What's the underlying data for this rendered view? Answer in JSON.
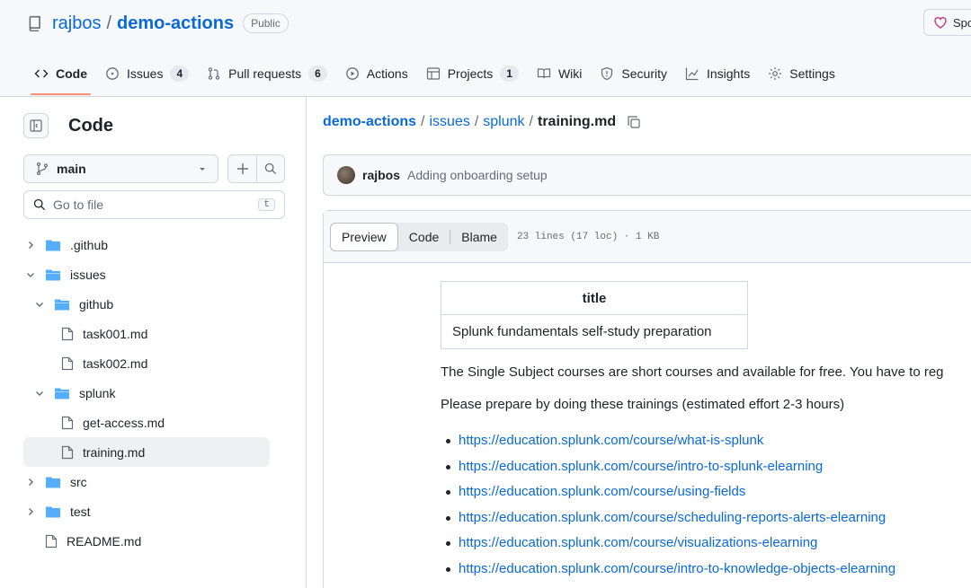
{
  "repo": {
    "owner": "rajbos",
    "separator": "/",
    "name": "demo-actions",
    "visibility": "Public",
    "sponsor_label": "Spo"
  },
  "tabs": [
    {
      "label": "Code",
      "icon": "code-icon",
      "active": true
    },
    {
      "label": "Issues",
      "count": "4",
      "icon": "issue-icon"
    },
    {
      "label": "Pull requests",
      "count": "6",
      "icon": "pull-request-icon"
    },
    {
      "label": "Actions",
      "icon": "play-icon"
    },
    {
      "label": "Projects",
      "count": "1",
      "icon": "table-icon"
    },
    {
      "label": "Wiki",
      "icon": "book-icon"
    },
    {
      "label": "Security",
      "icon": "shield-icon"
    },
    {
      "label": "Insights",
      "icon": "graph-icon"
    },
    {
      "label": "Settings",
      "icon": "gear-icon"
    }
  ],
  "sidebar": {
    "title": "Code",
    "branch": "main",
    "goto_placeholder": "Go to file",
    "goto_shortcut": "t",
    "tree": [
      {
        "label": ".github",
        "type": "folder",
        "expanded": false,
        "depth": 0
      },
      {
        "label": "issues",
        "type": "folder",
        "expanded": true,
        "depth": 0
      },
      {
        "label": "github",
        "type": "folder",
        "expanded": true,
        "depth": 1
      },
      {
        "label": "task001.md",
        "type": "file",
        "depth": 2
      },
      {
        "label": "task002.md",
        "type": "file",
        "depth": 2
      },
      {
        "label": "splunk",
        "type": "folder",
        "expanded": true,
        "depth": 1
      },
      {
        "label": "get-access.md",
        "type": "file",
        "depth": 2
      },
      {
        "label": "training.md",
        "type": "file",
        "depth": 2,
        "selected": true
      },
      {
        "label": "src",
        "type": "folder",
        "expanded": false,
        "depth": 0
      },
      {
        "label": "test",
        "type": "folder",
        "expanded": false,
        "depth": 0
      },
      {
        "label": "README.md",
        "type": "file",
        "depth": 0
      }
    ]
  },
  "breadcrumb": {
    "repo": "demo-actions",
    "sep": "/",
    "part1": "issues",
    "part2": "splunk",
    "file": "training.md"
  },
  "commit": {
    "author": "rajbos",
    "message": "Adding onboarding setup"
  },
  "file_view": {
    "modes": [
      "Preview",
      "Code",
      "Blame"
    ],
    "active_mode": "Preview",
    "meta": "23 lines (17 loc) · 1 KB"
  },
  "content": {
    "table_header": "title",
    "table_cell": "Splunk fundamentals self-study preparation",
    "para1": "The Single Subject courses are short courses and available for free. You have to reg",
    "para2": "Please prepare by doing these trainings (estimated effort 2-3 hours)",
    "links": [
      "https://education.splunk.com/course/what-is-splunk",
      "https://education.splunk.com/course/intro-to-splunk-elearning",
      "https://education.splunk.com/course/using-fields",
      "https://education.splunk.com/course/scheduling-reports-alerts-elearning",
      "https://education.splunk.com/course/visualizations-elearning",
      "https://education.splunk.com/course/intro-to-knowledge-objects-elearning"
    ]
  },
  "colors": {
    "link": "#0969da",
    "active_tab_underline": "#fd8c73",
    "folder": "#54aeff",
    "border": "#d0d7de"
  }
}
